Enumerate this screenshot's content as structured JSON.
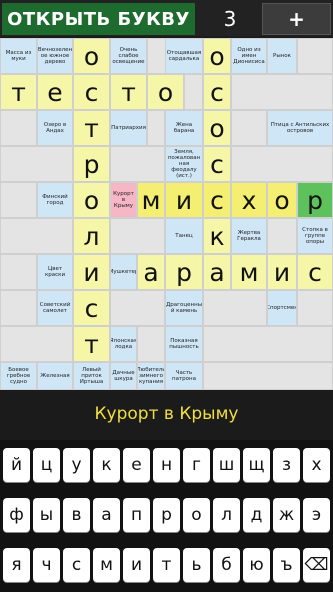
{
  "topbar": {
    "open_letter": "ОТКРЫТЬ БУКВУ",
    "count": "3",
    "plus": "+"
  },
  "grid": {
    "clues": [
      "Масса из муки",
      "Вечнозелен ое южное дерево",
      "Очень слабое освещение",
      "Отощавшая сардалька",
      "Одно из имен Дионисиса",
      "Рынок",
      "Озеро в Андах",
      "Патриархия",
      "Жена барана",
      "Птица с Антильских островов",
      "Земля, пожалован ная феодалу (ист.)",
      "Финский город",
      "Курорт в Крыму",
      "Танец",
      "Жертва Геракла",
      "Стопка в группе опоры",
      "Цвет краски",
      "Мушкетер",
      "Советский самолет",
      "Драгоценны й камень",
      "Спортсмен",
      "Японская лодка",
      "Показная пышность",
      "Боевое гребное судно",
      "Железная",
      "Левый приток Иртыша",
      "Дачные шкура",
      "Любитель зимнего купания",
      "Часть патрона"
    ],
    "letters": {
      "testo": [
        "т",
        "е",
        "с",
        "т",
        "о"
      ],
      "sosik": [
        "о",
        "с",
        "о",
        "с",
        "к"
      ],
      "otrolist": [
        "о",
        "т",
        "р",
        "о",
        "л",
        "и",
        "с",
        "т"
      ],
      "mishor": [
        "м",
        "и",
        "с",
        "х",
        "о",
        "р"
      ],
      "aramis": [
        "а",
        "р",
        "а",
        "м",
        "и",
        "с"
      ]
    }
  },
  "status": {
    "current_clue": "Курорт в Крыму"
  },
  "keyboard": {
    "row1": [
      "й",
      "ц",
      "у",
      "к",
      "е",
      "н",
      "г",
      "ш",
      "щ",
      "з",
      "х"
    ],
    "row2": [
      "ф",
      "ы",
      "в",
      "а",
      "п",
      "р",
      "о",
      "л",
      "д",
      "ж",
      "э"
    ],
    "row3": [
      "я",
      "ч",
      "с",
      "м",
      "и",
      "т",
      "ь",
      "б",
      "ю",
      "ъ"
    ],
    "backspace": "⌫"
  }
}
